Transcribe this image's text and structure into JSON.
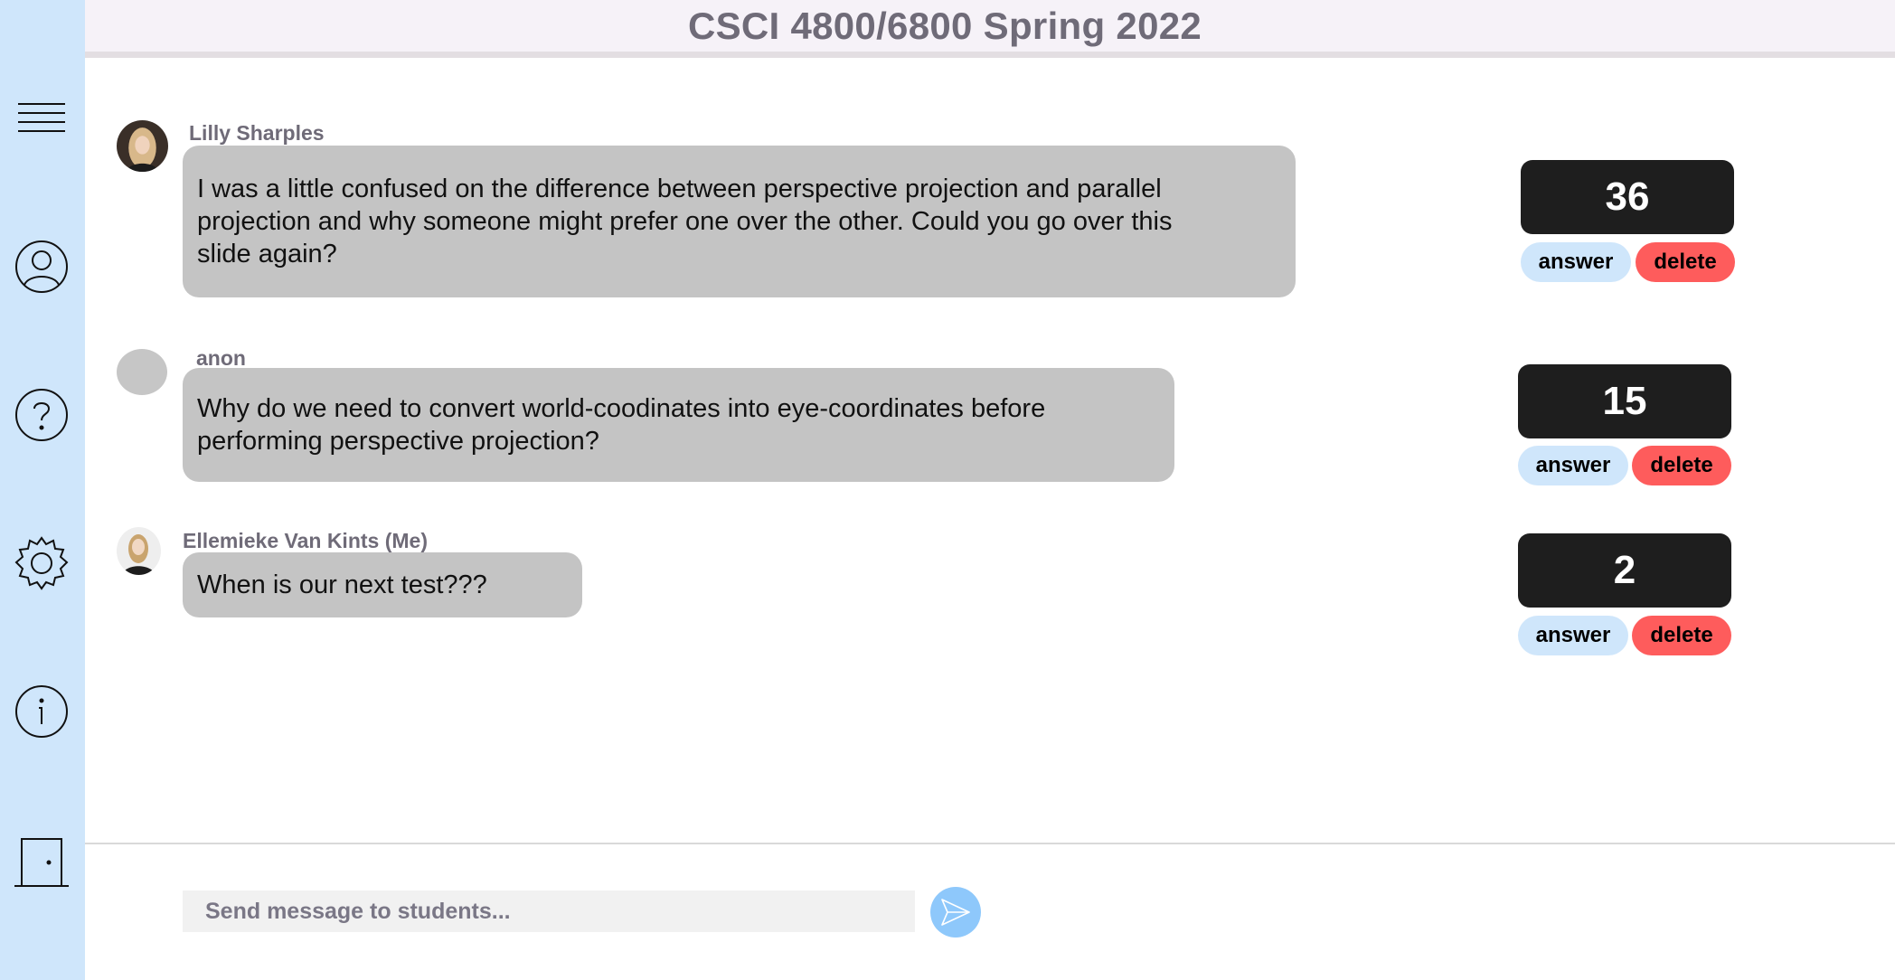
{
  "header": {
    "title": "CSCI 4800/6800 Spring 2022"
  },
  "sidebar": {
    "icons": [
      "menu-icon",
      "profile-icon",
      "help-icon",
      "settings-icon",
      "info-icon",
      "exit-door-icon"
    ]
  },
  "questions": [
    {
      "author": "Lilly Sharples",
      "text": "I was a little confused on the difference between perspective projection and parallel projection and why someone might prefer one over the other. Could you go over this slide again?",
      "votes": "36",
      "answer_label": "answer",
      "delete_label": "delete"
    },
    {
      "author": "anon",
      "text": "Why do we need to convert world-coodinates into eye-coordinates before performing perspective projection?",
      "votes": "15",
      "answer_label": "answer",
      "delete_label": "delete"
    },
    {
      "author": "Ellemieke Van Kints (Me)",
      "text": "When is our next test???",
      "votes": "2",
      "answer_label": "answer",
      "delete_label": "delete"
    }
  ],
  "composer": {
    "placeholder": "Send message to students..."
  },
  "colors": {
    "sidebar": "#cfe6fb",
    "answer": "#cfe6fb",
    "delete": "#fe5c5c",
    "vote_box": "#1e1e1e",
    "bubble": "#c4c4c4",
    "send": "#8ec8fb"
  }
}
